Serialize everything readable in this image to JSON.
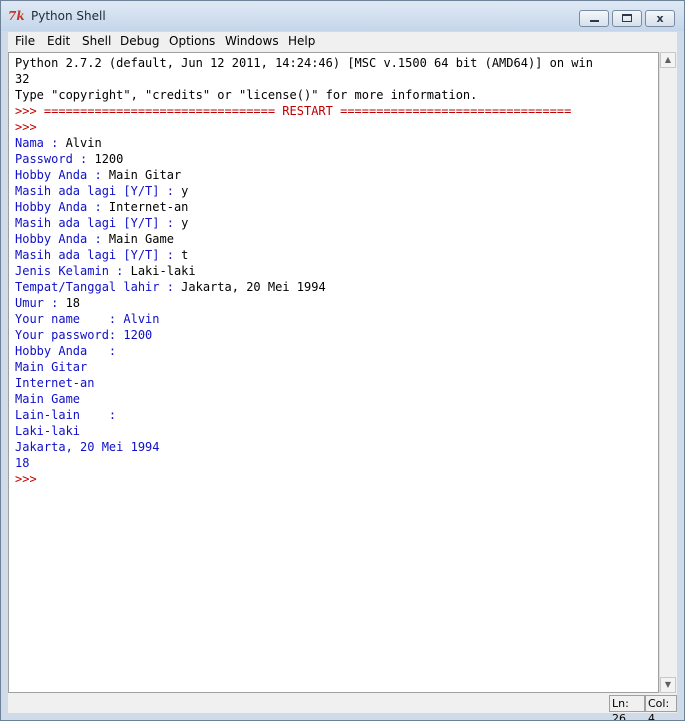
{
  "window": {
    "title": "Python Shell",
    "icon": "tk-feather-icon",
    "controls": {
      "minimize": "",
      "maximize": "",
      "close": "x"
    }
  },
  "menu": [
    "File",
    "Edit",
    "Shell",
    "Debug",
    "Options",
    "Windows",
    "Help"
  ],
  "shell": {
    "colors": {
      "output": "#000000",
      "prompt": "#c00000",
      "stdout": "#1010c8"
    },
    "lines": [
      {
        "kind": "out",
        "text": "Python 2.7.2 (default, Jun 12 2011, 14:24:46) [MSC v.1500 64 bit (AMD64)] on win"
      },
      {
        "kind": "out",
        "text": "32"
      },
      {
        "kind": "out",
        "text": "Type \"copyright\", \"credits\" or \"license()\" for more information."
      },
      {
        "kind": "prompt",
        "text": ">>> ================================ RESTART ================================"
      },
      {
        "kind": "prompt",
        "text": ">>> "
      },
      {
        "parts": [
          {
            "kind": "stdout",
            "text": "Nama : "
          },
          {
            "kind": "out",
            "text": "Alvin"
          }
        ]
      },
      {
        "parts": [
          {
            "kind": "stdout",
            "text": "Password : "
          },
          {
            "kind": "out",
            "text": "1200"
          }
        ]
      },
      {
        "parts": [
          {
            "kind": "stdout",
            "text": "Hobby Anda : "
          },
          {
            "kind": "out",
            "text": "Main Gitar"
          }
        ]
      },
      {
        "parts": [
          {
            "kind": "stdout",
            "text": "Masih ada lagi [Y/T] : "
          },
          {
            "kind": "out",
            "text": "y"
          }
        ]
      },
      {
        "parts": [
          {
            "kind": "stdout",
            "text": "Hobby Anda : "
          },
          {
            "kind": "out",
            "text": "Internet-an"
          }
        ]
      },
      {
        "parts": [
          {
            "kind": "stdout",
            "text": "Masih ada lagi [Y/T] : "
          },
          {
            "kind": "out",
            "text": "y"
          }
        ]
      },
      {
        "parts": [
          {
            "kind": "stdout",
            "text": "Hobby Anda : "
          },
          {
            "kind": "out",
            "text": "Main Game"
          }
        ]
      },
      {
        "parts": [
          {
            "kind": "stdout",
            "text": "Masih ada lagi [Y/T] : "
          },
          {
            "kind": "out",
            "text": "t"
          }
        ]
      },
      {
        "parts": [
          {
            "kind": "stdout",
            "text": "Jenis Kelamin : "
          },
          {
            "kind": "out",
            "text": "Laki-laki"
          }
        ]
      },
      {
        "parts": [
          {
            "kind": "stdout",
            "text": "Tempat/Tanggal lahir : "
          },
          {
            "kind": "out",
            "text": "Jakarta, 20 Mei 1994"
          }
        ]
      },
      {
        "parts": [
          {
            "kind": "stdout",
            "text": "Umur : "
          },
          {
            "kind": "out",
            "text": "18"
          }
        ]
      },
      {
        "kind": "stdout",
        "text": "Your name    : Alvin"
      },
      {
        "kind": "stdout",
        "text": "Your password: 1200"
      },
      {
        "kind": "stdout",
        "text": "Hobby Anda   :"
      },
      {
        "kind": "stdout",
        "text": "Main Gitar"
      },
      {
        "kind": "stdout",
        "text": "Internet-an"
      },
      {
        "kind": "stdout",
        "text": "Main Game"
      },
      {
        "kind": "stdout",
        "text": "Lain-lain    :"
      },
      {
        "kind": "stdout",
        "text": "Laki-laki"
      },
      {
        "kind": "stdout",
        "text": "Jakarta, 20 Mei 1994"
      },
      {
        "kind": "stdout",
        "text": "18"
      },
      {
        "kind": "prompt",
        "text": ">>> "
      }
    ]
  },
  "status": {
    "line": "Ln: 26",
    "col": "Col: 4"
  }
}
